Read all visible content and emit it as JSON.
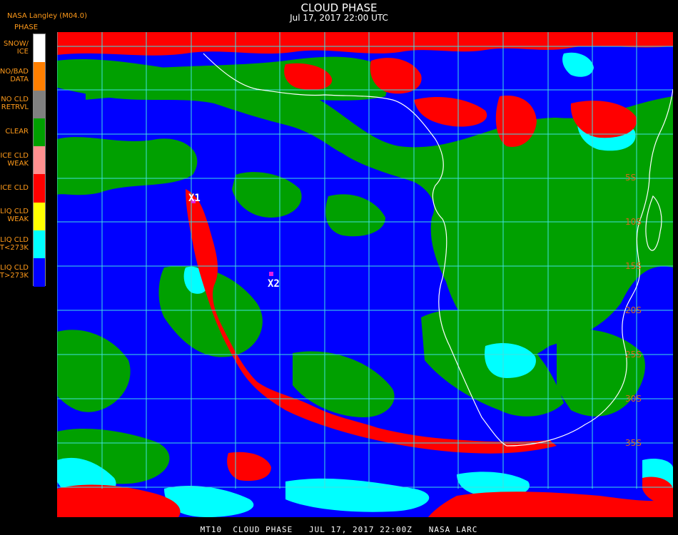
{
  "header": {
    "org": "NASA Langley (M04.0)",
    "title": "CLOUD PHASE",
    "subtitle": "Jul 17, 2017 22:00 UTC"
  },
  "legend": {
    "title": "PHASE",
    "items": [
      {
        "lines": [
          "SNOW/",
          "ICE"
        ],
        "color": "#ffffff"
      },
      {
        "lines": [
          "NO/BAD",
          "DATA"
        ],
        "color": "#ff7f00"
      },
      {
        "lines": [
          "NO CLD",
          "RETRVL"
        ],
        "color": "#808080"
      },
      {
        "lines": [
          "CLEAR"
        ],
        "color": "#00a000"
      },
      {
        "lines": [
          "ICE CLD",
          "WEAK"
        ],
        "color": "#ff9090"
      },
      {
        "lines": [
          "ICE CLD"
        ],
        "color": "#ff0000"
      },
      {
        "lines": [
          "LIQ CLD",
          "WEAK"
        ],
        "color": "#ffff00"
      },
      {
        "lines": [
          "LIQ CLD",
          "T<273K"
        ],
        "color": "#00ffff"
      },
      {
        "lines": [
          "LIQ CLD",
          "T>273K"
        ],
        "color": "#0000ff"
      }
    ]
  },
  "map": {
    "markers": [
      {
        "label": "X1"
      },
      {
        "label": "X2"
      }
    ],
    "lat_labels": [
      "5S",
      "10S",
      "15S",
      "20S",
      "25S",
      "30S",
      "35S"
    ],
    "colors": {
      "grid": "#40e0e0",
      "coast": "#ffffff",
      "lat_label": "#d4681c",
      "marker": "#e020e0"
    }
  },
  "footer": {
    "text": "MT10  CLOUD PHASE   JUL 17, 2017 22:00Z   NASA LARC"
  }
}
